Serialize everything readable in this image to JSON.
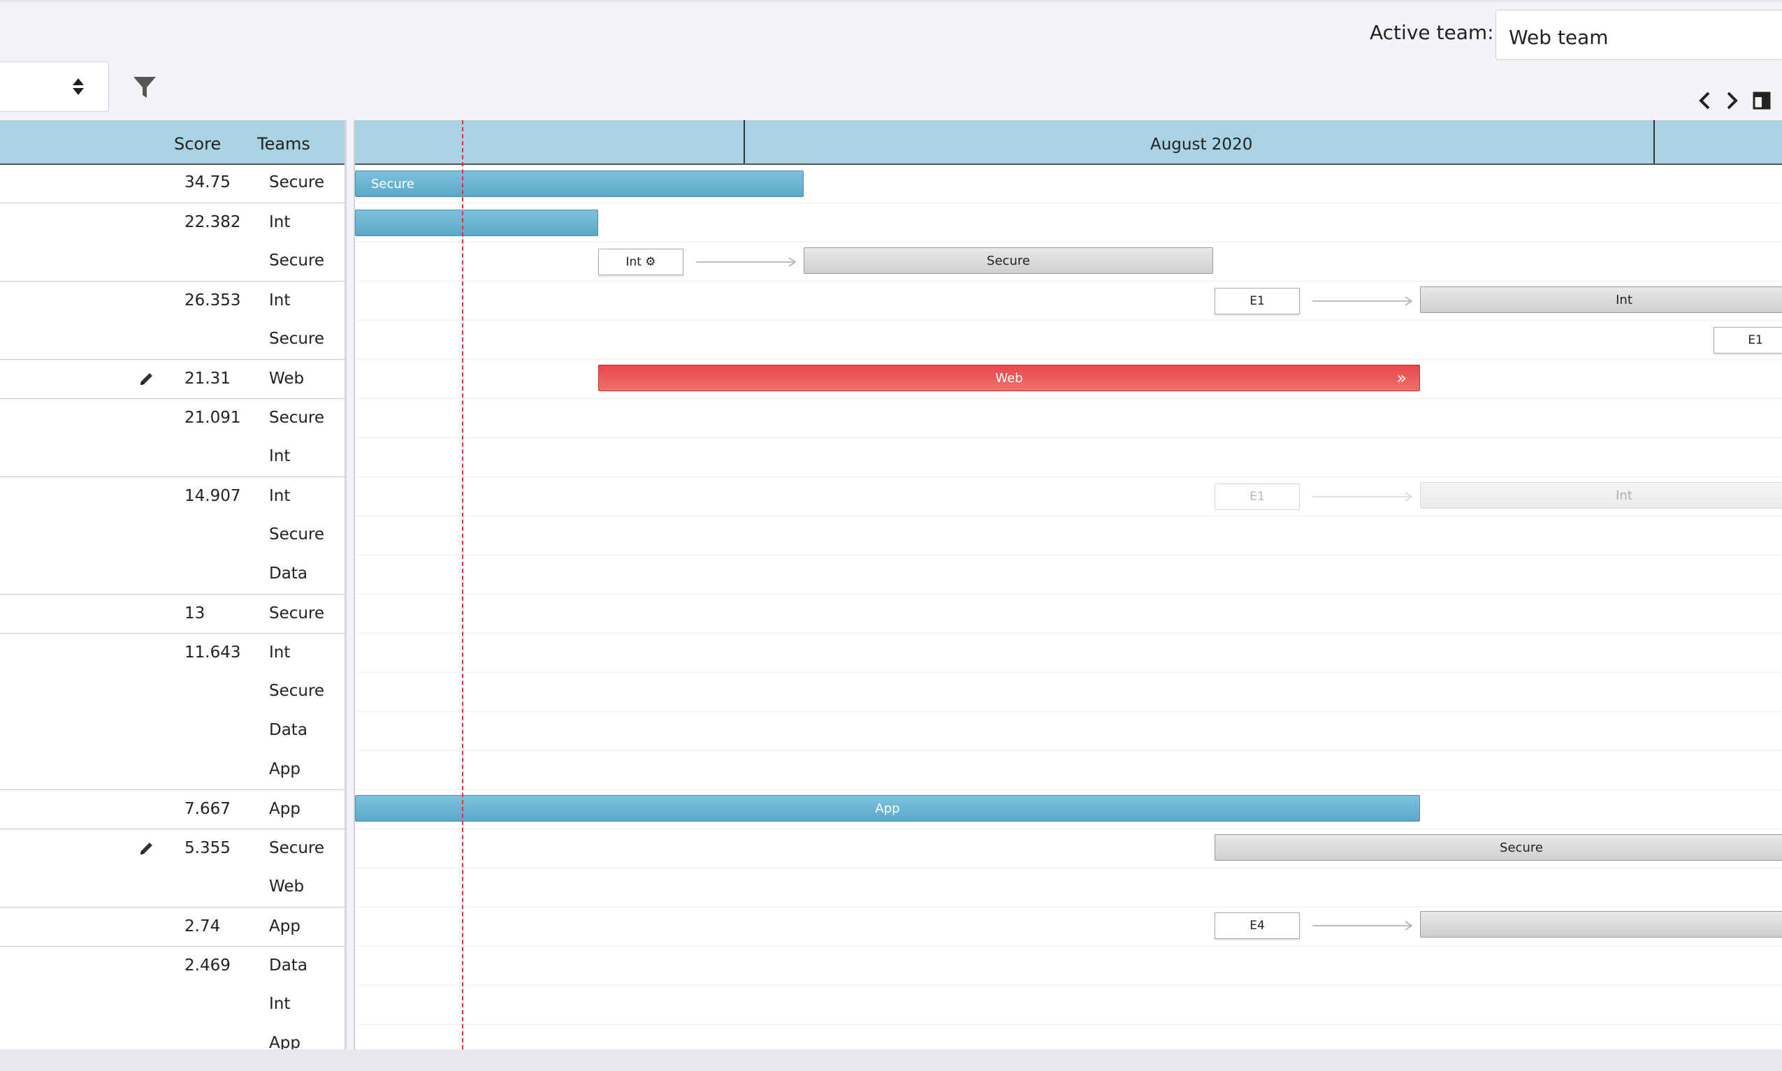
{
  "header": {
    "active_team_label": "Active team:",
    "active_team_value": "Web team"
  },
  "table": {
    "columns": {
      "score": "Score",
      "teams": "Teams"
    },
    "rows": [
      {
        "score": "34.75",
        "team": "Secure"
      },
      {
        "score": "22.382",
        "team": "Int"
      },
      {
        "score": "",
        "team": "Secure"
      },
      {
        "score": "26.353",
        "team": "Int"
      },
      {
        "score": "",
        "team": "Secure"
      },
      {
        "score": "21.31",
        "team": "Web"
      },
      {
        "score": "21.091",
        "team": "Secure"
      },
      {
        "score": "",
        "team": "Int"
      },
      {
        "score": "14.907",
        "team": "Int"
      },
      {
        "score": "",
        "team": "Secure"
      },
      {
        "score": "",
        "team": "Data"
      },
      {
        "score": "13",
        "team": "Secure"
      },
      {
        "score": "11.643",
        "team": "Int"
      },
      {
        "score": "",
        "team": "Secure"
      },
      {
        "score": "",
        "team": "Data"
      },
      {
        "score": "",
        "team": "App"
      },
      {
        "score": "7.667",
        "team": "App"
      },
      {
        "score": "5.355",
        "team": "Secure"
      },
      {
        "score": "",
        "team": "Web"
      },
      {
        "score": "2.74",
        "team": "App"
      },
      {
        "score": "2.469",
        "team": "Data"
      },
      {
        "score": "",
        "team": "Int"
      },
      {
        "score": "",
        "team": "App"
      }
    ]
  },
  "gantt": {
    "month_label": "August 2020",
    "bars": {
      "r0": "Secure",
      "r2_ms": "Int ⚙",
      "r2_bar": "Secure",
      "r3_ms": "E1",
      "r3_bar": "Int",
      "r4_ms": "E1",
      "r5_bar": "Web",
      "r5_arrow": "»",
      "r8_ms": "E1",
      "r8_bar": "Int",
      "r16_bar": "App",
      "r17_bar": "Secure",
      "r19_ms": "E4"
    }
  },
  "icons": {
    "filter": "filter-icon",
    "prev": "chevron-left-icon",
    "next": "chevron-right-icon",
    "layout": "layout-toggle-icon",
    "edit": "pencil-icon",
    "sort": "sort-arrows-icon"
  },
  "colors": {
    "header_bg": "#a9d3e2",
    "bar_blue": "#5aa9c9",
    "bar_red": "#e84848",
    "today_line": "#d03a3a"
  }
}
